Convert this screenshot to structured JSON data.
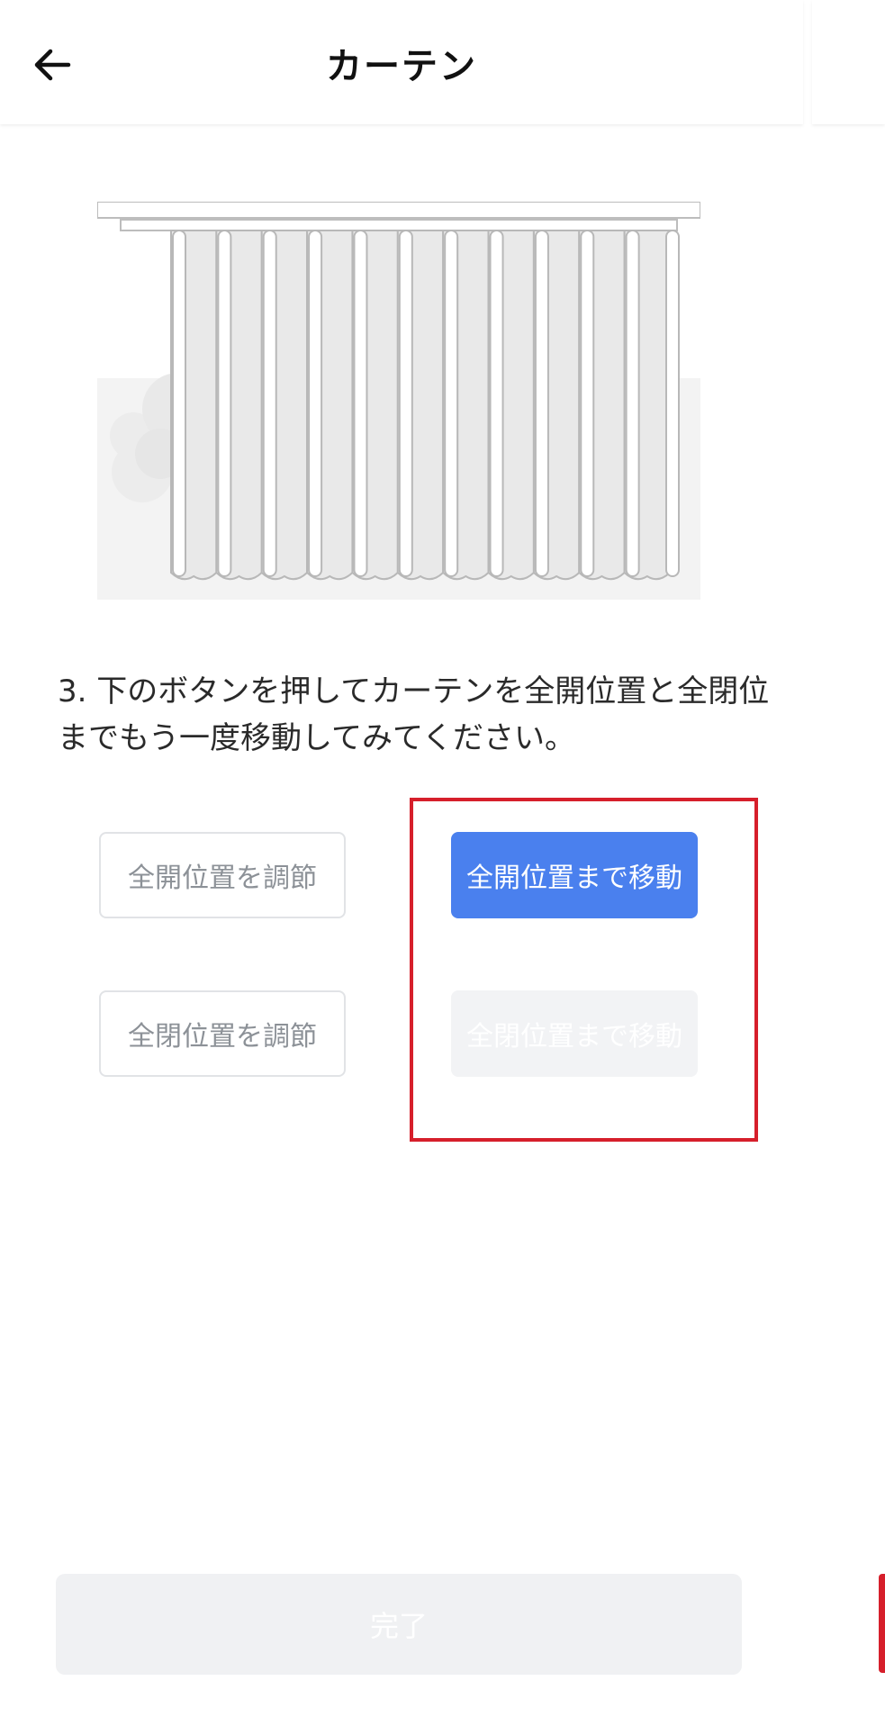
{
  "header": {
    "back_icon": "arrow-left-icon",
    "title": "カーテン"
  },
  "instruction": {
    "line1": "3. 下のボタンを押してカーテンを全開位置と全閉位",
    "line2": "までもう一度移動してみてください。"
  },
  "buttons": {
    "adjust_open": "全開位置を調節",
    "move_open": "全開位置まで移動",
    "adjust_close": "全閉位置を調節",
    "move_close": "全閉位置まで移動"
  },
  "footer": {
    "done": "完了"
  },
  "colors": {
    "primary": "#4a80ee",
    "highlight": "#d61f2b",
    "disabled": "#f2f3f5"
  }
}
